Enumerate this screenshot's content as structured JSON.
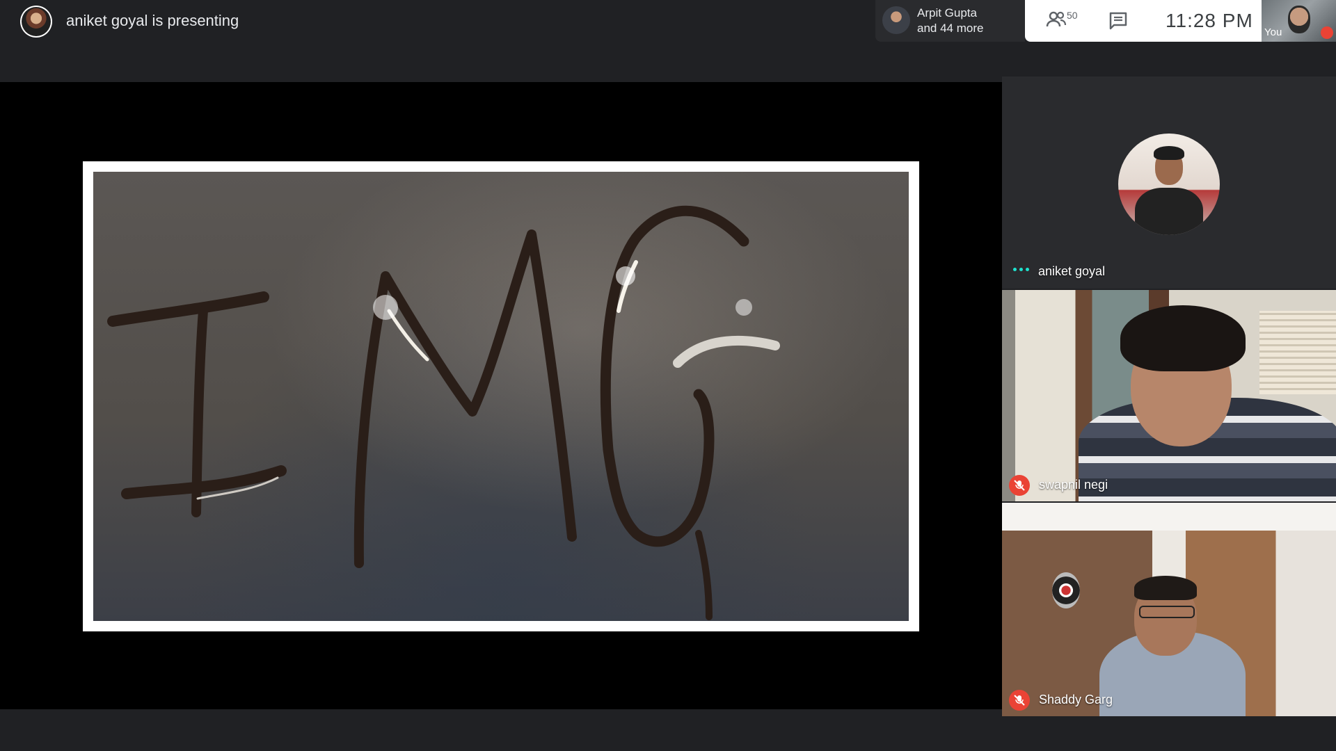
{
  "header": {
    "presenting_text": "aniket goyal is presenting"
  },
  "participants_chip": {
    "line1": "Arpit Gupta",
    "line2": "and 44 more"
  },
  "controls": {
    "people_icon": "people-icon",
    "people_count": "50",
    "chat_icon": "chat-icon",
    "time": "11:28  PM"
  },
  "self_view": {
    "label": "You",
    "muted": true
  },
  "presentation": {
    "slide_icon": "image-slide"
  },
  "tiles": [
    {
      "name": "aniket goyal",
      "speaking": true,
      "muted": false,
      "display": "avatar"
    },
    {
      "name": "swapnil negi",
      "muted": true,
      "display": "video"
    },
    {
      "name": "Shaddy Garg",
      "muted": true,
      "display": "video"
    }
  ],
  "colors": {
    "background": "#202124",
    "stage": "#000000",
    "muted_badge": "#ea4335",
    "speaking_dots": "#1ee3cf",
    "controls_bg": "#ffffff"
  }
}
